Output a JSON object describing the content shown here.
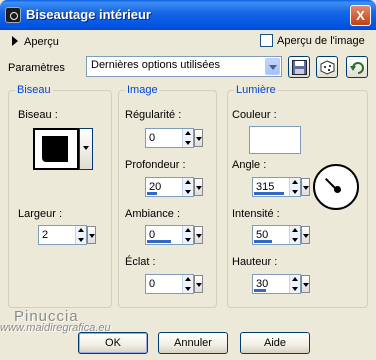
{
  "window": {
    "title": "Biseautage intérieur",
    "close_label": "X"
  },
  "preview": {
    "toggle_label": "Aperçu",
    "image_preview_label": "Aperçu de l'image"
  },
  "params": {
    "label": "Paramètres",
    "selected": "Dernières options utilisées"
  },
  "bevel_group": {
    "legend": "Biseau",
    "bevel_label": "Biseau :",
    "width_label": "Largeur :",
    "width_value": "2"
  },
  "image_group": {
    "legend": "Image",
    "smoothness_label": "Régularité :",
    "smoothness_value": "0",
    "depth_label": "Profondeur :",
    "depth_value": "20",
    "ambience_label": "Ambiance :",
    "ambience_value": "0",
    "shininess_label": "Éclat :",
    "shininess_value": "0"
  },
  "light_group": {
    "legend": "Lumière",
    "color_label": "Couleur :",
    "color_value": "#ffffff",
    "angle_label": "Angle :",
    "angle_value": "315",
    "intensity_label": "Intensité :",
    "intensity_value": "50",
    "elevation_label": "Hauteur :",
    "elevation_value": "30"
  },
  "buttons": {
    "ok": "OK",
    "cancel": "Annuler",
    "help": "Aide"
  },
  "watermark": {
    "name": "Pinuccia",
    "url": "www.maidiregrafica.eu"
  }
}
